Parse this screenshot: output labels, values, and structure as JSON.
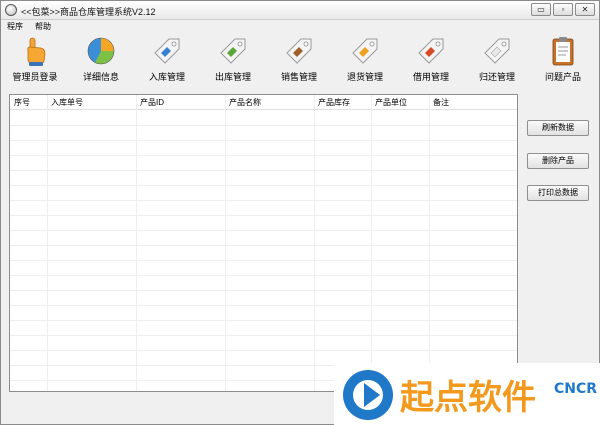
{
  "window": {
    "title": "<<包菜>>商品仓库管理系统V2.12",
    "controls": [
      "▭",
      "▫",
      "✕"
    ]
  },
  "menu": [
    "程序",
    "帮助"
  ],
  "toolbar": [
    {
      "label": "管理员登录",
      "icon": "hand-pointer-icon"
    },
    {
      "label": "详细信息",
      "icon": "pie-chart-icon"
    },
    {
      "label": "入库管理",
      "icon": "tag-blue-icon"
    },
    {
      "label": "出库管理",
      "icon": "tag-green-icon"
    },
    {
      "label": "销售管理",
      "icon": "tag-brown-icon"
    },
    {
      "label": "退货管理",
      "icon": "tag-orange-icon"
    },
    {
      "label": "借用管理",
      "icon": "tag-red-icon"
    },
    {
      "label": "归还管理",
      "icon": "tag-white-icon"
    },
    {
      "label": "问题产品",
      "icon": "clipboard-icon"
    }
  ],
  "table": {
    "columns": [
      "序号",
      "入库单号",
      "产品ID",
      "产品名称",
      "产品库存",
      "产品单位",
      "备注"
    ],
    "rows": []
  },
  "actions": {
    "refresh": "刷新数据",
    "delete": "删除产品",
    "print": "打印总数据"
  },
  "watermark": {
    "text": "起点软件",
    "sub": "CNCR"
  },
  "colors": {
    "accent_orange": "#f39a1e",
    "accent_blue": "#1f78c8"
  }
}
